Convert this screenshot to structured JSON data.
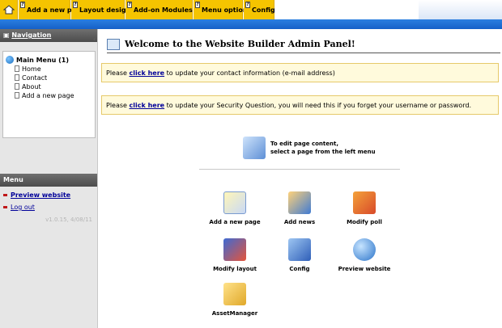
{
  "topbar": {
    "menus": [
      {
        "label": "Add a new page"
      },
      {
        "label": "Layout design"
      },
      {
        "label": "Add-on Modules"
      },
      {
        "label": "Menu options"
      },
      {
        "label": "Config"
      }
    ],
    "help_glyph": "?"
  },
  "sidebar": {
    "navigation_header": "Navigation",
    "tree": {
      "root": "Main Menu (1)",
      "items": [
        "Home",
        "Contact",
        "About",
        "Add a new page"
      ]
    },
    "menu_header": "Menu",
    "links": [
      "Preview website",
      "Log out"
    ],
    "version": "v1.0.15, 4/08/11"
  },
  "main": {
    "welcome_title": "Welcome to the Website Builder Admin Panel!",
    "notice1": {
      "prefix": "Please ",
      "link": "click here",
      "suffix": " to update your contact information (e-mail address)"
    },
    "notice2": {
      "prefix": "Please ",
      "link": "click here",
      "suffix": " to update your Security Question, you will need this if you forget your username or password."
    },
    "edit_tip": {
      "line1": "To edit page content,",
      "line2": "select a page from the left menu"
    },
    "tiles": [
      "Add a new page",
      "Add news",
      "Modify poll",
      "Modify layout",
      "Config",
      "Preview website",
      "AssetManager"
    ]
  },
  "colors": {
    "menu_yellow": "#f5c400",
    "top_blue": "#1560c8",
    "notice_bg": "#fffadc",
    "link_blue": "#000099"
  }
}
